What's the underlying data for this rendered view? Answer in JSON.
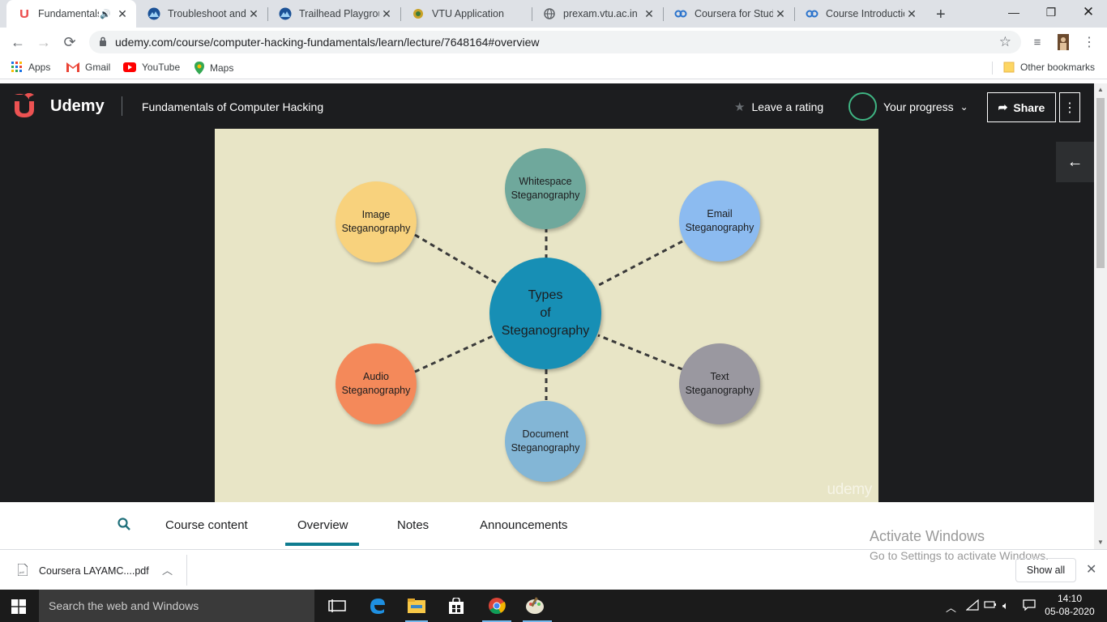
{
  "browser": {
    "tabs": [
      {
        "title": "Fundamentals",
        "icon": "udemy-icon",
        "active": true,
        "audio": true
      },
      {
        "title": "Troubleshoot and",
        "icon": "trailhead-icon"
      },
      {
        "title": "Trailhead Playgrou",
        "icon": "trailhead-icon"
      },
      {
        "title": "VTU Application",
        "icon": "vtu-icon"
      },
      {
        "title": "prexam.vtu.ac.in",
        "icon": "globe-icon"
      },
      {
        "title": "Coursera for Stude",
        "icon": "coursera-icon"
      },
      {
        "title": "Course Introductic",
        "icon": "coursera-icon"
      }
    ],
    "url": "udemy.com/course/computer-hacking-fundamentals/learn/lecture/7648164#overview",
    "bookmarks": [
      {
        "label": "Apps",
        "icon": "apps-grid-icon"
      },
      {
        "label": "Gmail",
        "icon": "gmail-icon"
      },
      {
        "label": "YouTube",
        "icon": "youtube-icon"
      },
      {
        "label": "Maps",
        "icon": "maps-icon"
      }
    ],
    "other_bookmarks": "Other bookmarks"
  },
  "header": {
    "logo": "Udemy",
    "course_title": "Fundamentals of Computer Hacking",
    "rating": "Leave a rating",
    "progress": "Your progress",
    "share": "Share"
  },
  "slide": {
    "center": "Types\nof\nSteganography",
    "nodes": [
      {
        "key": "whitespace",
        "label": "Whitespace\nSteganography",
        "color": "#6fa89c"
      },
      {
        "key": "image",
        "label": "Image\nSteganography",
        "color": "#f8d27d"
      },
      {
        "key": "email",
        "label": "Email\nSteganography",
        "color": "#8cbbf0"
      },
      {
        "key": "audio",
        "label": "Audio\nSteganography",
        "color": "#f4895a"
      },
      {
        "key": "document",
        "label": "Document\nSteganography",
        "color": "#83b6d6"
      },
      {
        "key": "text",
        "label": "Text\nSteganography",
        "color": "#9a98a0"
      }
    ],
    "center_color": "#178fb5",
    "watermark": "udemy"
  },
  "lecture_tabs": {
    "items": [
      "Course content",
      "Overview",
      "Notes",
      "Announcements"
    ],
    "active": "Overview"
  },
  "activation": {
    "title": "Activate Windows",
    "subtitle": "Go to Settings to activate Windows."
  },
  "downloads": {
    "file": "Coursera LAYAMC....pdf",
    "show_all": "Show all"
  },
  "taskbar": {
    "search_placeholder": "Search the web and Windows",
    "time": "14:10",
    "date": "05-08-2020"
  }
}
